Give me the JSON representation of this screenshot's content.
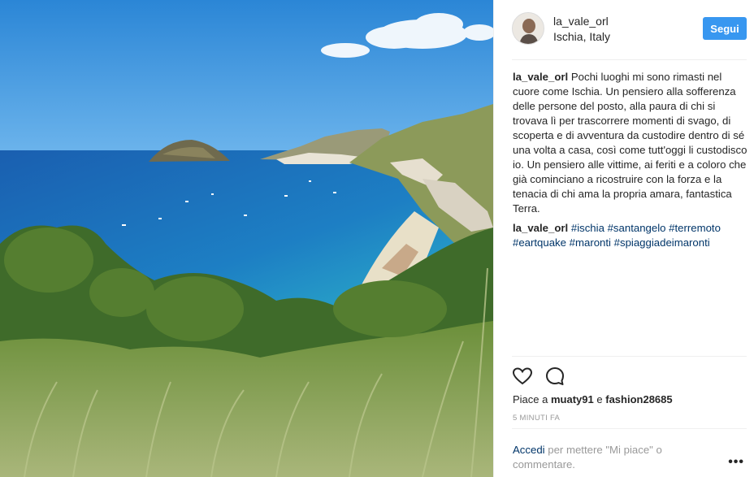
{
  "post": {
    "username": "la_vale_orl",
    "location": "Ischia, Italy",
    "follow_label": "Segui",
    "caption_user": "la_vale_orl",
    "caption_text": "Pochi luoghi mi sono rimasti nel cuore come Ischia. Un pensiero alla sofferenza delle persone del posto, alla paura di chi si trovava lì per trascorrere momenti di svago, di scoperta e di avventura da custodire dentro di sé una volta a casa, così come tutt'oggi li custodisco io. Un pensiero alle vittime, ai feriti e a coloro che già cominciano a ricostruire con la forza e la tenacia di chi ama la propria amara, fantastica Terra.",
    "comment_user": "la_vale_orl",
    "hashtags": [
      "#ischia",
      "#santangelo",
      "#terremoto",
      "#eartquake",
      "#maronti",
      "#spiaggiadeimaronti"
    ],
    "likes_prefix": "Piace a",
    "likes_user1": "muaty91",
    "likes_conj": "e",
    "likes_user2": "fashion28685",
    "timestamp": "5 MINUTI FA",
    "login_link": "Accedi",
    "login_text": "per mettere \"Mi piace\" o commentare.",
    "more_label": "•••"
  },
  "icons": {
    "like": "heart-icon",
    "comment": "comment-bubble-icon",
    "more": "more-options-icon"
  },
  "colors": {
    "follow_button": "#3897f0",
    "hashtag": "#003569",
    "text": "#262626",
    "muted": "#999999"
  }
}
